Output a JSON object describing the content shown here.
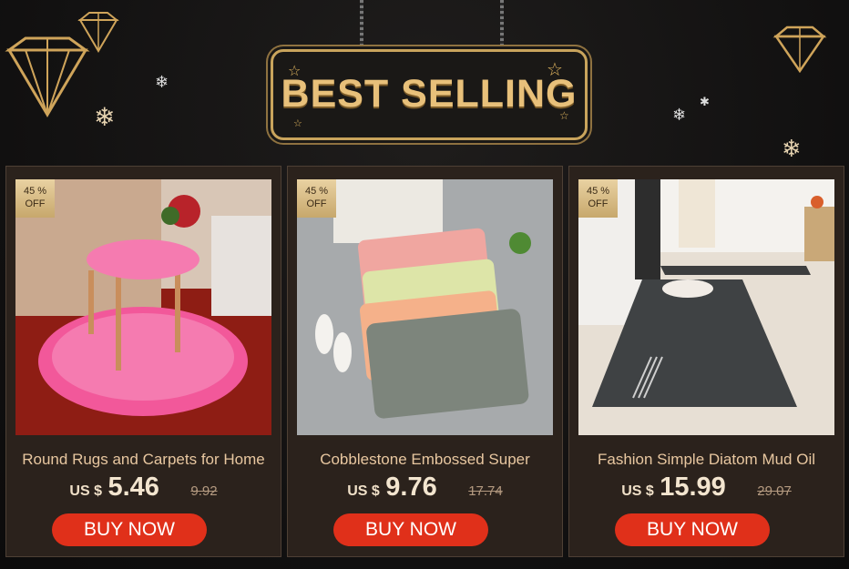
{
  "header": {
    "title": "BEST SELLING"
  },
  "products": [
    {
      "discount_value": "45 %",
      "discount_label": "OFF",
      "title": "Round Rugs and Carpets for Home",
      "currency": "US $",
      "price": "5.46",
      "original_price": "9.92",
      "buy_label": "BUY NOW"
    },
    {
      "discount_value": "45 %",
      "discount_label": "OFF",
      "title": "Cobblestone Embossed Super",
      "currency": "US $",
      "price": "9.76",
      "original_price": "17.74",
      "buy_label": "BUY NOW"
    },
    {
      "discount_value": "45 %",
      "discount_label": "OFF",
      "title": "Fashion Simple Diatom Mud Oil",
      "currency": "US $",
      "price": "15.99",
      "original_price": "29.07",
      "buy_label": "BUY NOW"
    }
  ],
  "colors": {
    "accent_gold": "#e8c07a",
    "buy_button": "#e0301a",
    "card_background": "#2b221c"
  }
}
